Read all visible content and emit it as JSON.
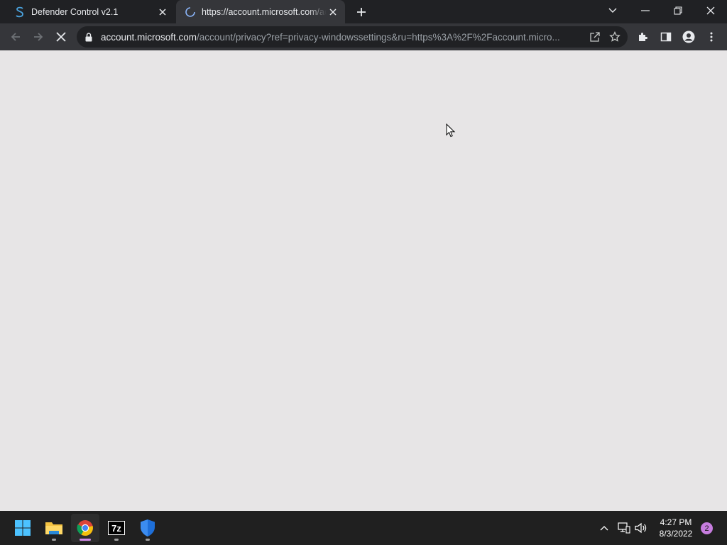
{
  "tabs": [
    {
      "title": "Defender Control v2.1",
      "favicon": "s-logo-icon"
    },
    {
      "title": "https://account.microsoft.com/account/privacy",
      "favicon": "loading-spinner-icon"
    }
  ],
  "omnibox": {
    "host": "account.microsoft.com",
    "path": "/account/privacy?ref=privacy-windowssettings&ru=https%3A%2F%2Faccount.micro..."
  },
  "clock": {
    "time": "4:27 PM",
    "date": "8/3/2022"
  },
  "notification_count": "2",
  "taskbar_apps": [
    "start-icon",
    "file-explorer-icon",
    "chrome-icon",
    "7zip-icon",
    "defender-shield-icon"
  ],
  "colors": {
    "titlebar": "#202124",
    "toolbar": "#35363a",
    "page": "#e7e5e6",
    "taskbar": "#202020",
    "accent": "#c77ddf"
  }
}
